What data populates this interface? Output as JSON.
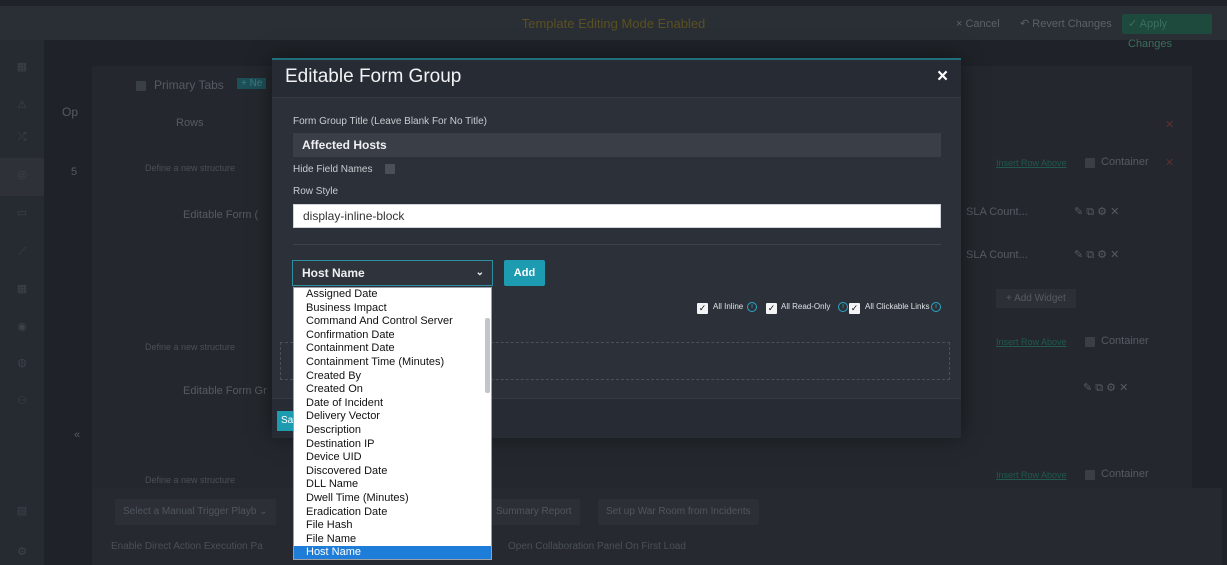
{
  "topbar": {
    "title": "Template Editing Mode Enabled",
    "cancel": "× Cancel",
    "revert": "↶ Revert Changes",
    "apply": "✓ Apply Changes"
  },
  "background": {
    "primary_tabs": "Primary Tabs",
    "new_tab": "+ Ne",
    "rows": "Rows",
    "op": "Op",
    "five": "5",
    "define1": "Define a new structure",
    "define2": "Define a new structure",
    "define3": "Define a new structure",
    "editable_form1": "Editable Form (",
    "editable_form2": "Editable Form Gr",
    "insert_row1": "Insert Row Above",
    "insert_row2": "Insert Row Above",
    "insert_row3": "Insert Row Above",
    "container1": "Container",
    "container2": "Container",
    "container3": "Container",
    "sla1": "SLA Count...",
    "sla2": "SLA Count...",
    "add_widget": "+ Add Widget",
    "collapse": "«",
    "manual_trigger": "Select a Manual Trigger Playb ⌄",
    "summary_report": "Summary Report",
    "war_room": "Set up War Room from Incidents",
    "enable_direct": "Enable Direct Action Execution Pa",
    "open_collab": "Open Collaboration Panel On First Load"
  },
  "modal": {
    "title": "Editable Form Group",
    "close": "×",
    "form_group_title_label": "Form Group Title (Leave Blank For No Title)",
    "form_group_title_value": "Affected Hosts",
    "hide_field_names_label": "Hide Field Names",
    "row_style_label": "Row Style",
    "row_style_value": "display-inline-block",
    "selected_field": "Host Name",
    "add_label": "Add",
    "all_inline": "All Inline",
    "all_readonly": "All Read-Only",
    "all_clickable": "All Clickable Links",
    "save_label": "Sa"
  },
  "dropdown": {
    "options": [
      "Assigned Date",
      "Business Impact",
      "Command And Control Server",
      "Confirmation Date",
      "Containment Date",
      "Containment Time (Minutes)",
      "Created By",
      "Created On",
      "Date of Incident",
      "Delivery Vector",
      "Description",
      "Destination IP",
      "Device UID",
      "Discovered Date",
      "DLL Name",
      "Dwell Time (Minutes)",
      "Eradication Date",
      "File Hash",
      "File Name",
      "Host Name"
    ],
    "selected": "Host Name"
  },
  "colors": {
    "accent": "#1d9bb0",
    "selected_option": "#1e7dd8",
    "modal_bg": "#2c3139"
  }
}
